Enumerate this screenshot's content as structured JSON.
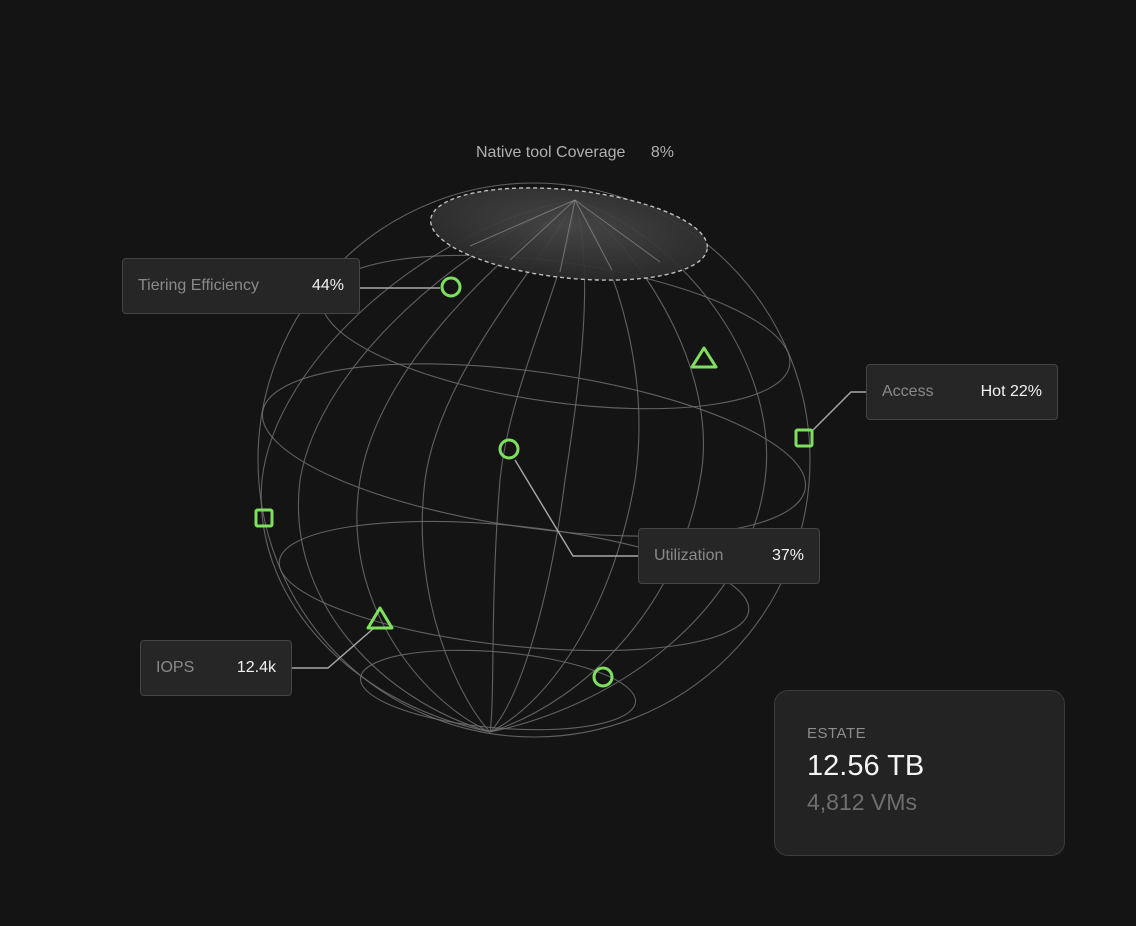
{
  "native_coverage": {
    "label": "Native tool Coverage",
    "value": "8%"
  },
  "callouts": {
    "tiering": {
      "label": "Tiering Efficiency",
      "value": "44%"
    },
    "access": {
      "label": "Access",
      "value": "Hot 22%"
    },
    "utilization": {
      "label": "Utilization",
      "value": "37%"
    },
    "iops": {
      "label": "IOPS",
      "value": "12.4k"
    }
  },
  "estate": {
    "label": "ESTATE",
    "capacity": "12.56 TB",
    "vms": "4,812 VMs"
  },
  "colors": {
    "background": "#141414",
    "accent": "#7fe060",
    "wire": "#6e6e6e",
    "card": "#262626"
  },
  "markers": [
    {
      "kind": "circle",
      "name": "tiering-marker-icon"
    },
    {
      "kind": "triangle",
      "name": "triangle-marker-icon"
    },
    {
      "kind": "square",
      "name": "access-marker-icon"
    },
    {
      "kind": "circle",
      "name": "utilization-marker-icon"
    },
    {
      "kind": "square",
      "name": "square-marker-icon"
    },
    {
      "kind": "triangle",
      "name": "iops-marker-icon"
    },
    {
      "kind": "circle",
      "name": "circle-marker-icon"
    }
  ]
}
